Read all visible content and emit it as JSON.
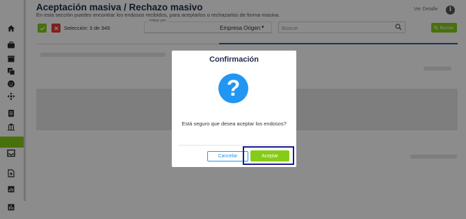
{
  "header": {
    "title": "Aceptación masiva / Rechazo masivo",
    "subtitle": "En esta sección puedes encontrar los endosos recibidos, para aceptarlos o rechazarlos de forma masiva.",
    "ver_detalle": "Ver Detalle",
    "info_icon": "i"
  },
  "toolbar": {
    "seleccion": "Selección: 3 de 349",
    "filter_label": "Filtrar por",
    "filter_value": "Empresa Origen",
    "search_placeholder": "Buscar",
    "buscar_label": "Buscar"
  },
  "modal": {
    "title": "Confirmación",
    "icon_glyph": "?",
    "message": "Está seguro que desea aceptar los endosos?",
    "cancel_label": "Cancelar",
    "accept_label": "Aceptar"
  },
  "colors": {
    "accent_green": "#84cc16",
    "reject_red": "#e53935",
    "info_blue": "#2196f3",
    "title_navy": "#1d2b4f",
    "highlight": "#1a1a8c"
  },
  "sidebar": {
    "icons": [
      "home-icon",
      "briefcase-icon",
      "store-icon",
      "copy-icon",
      "face-icon",
      "move-icon",
      "clipboard-icon",
      "bank-icon",
      "active-item",
      "inbox-icon",
      "add-doc-icon",
      "report-icon",
      "chart-icon"
    ]
  }
}
